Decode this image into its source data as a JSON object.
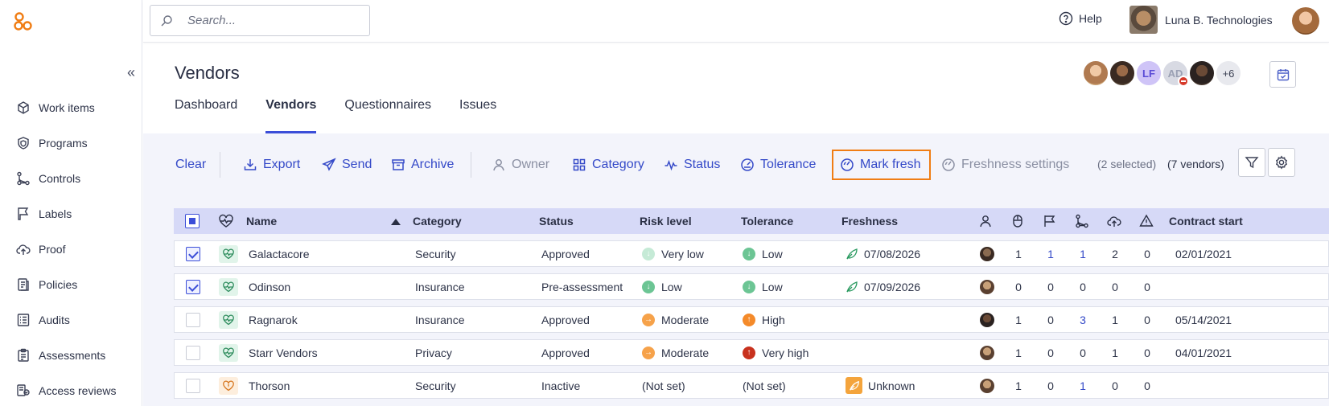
{
  "sidebar": {
    "collapse_label": "«",
    "items": [
      {
        "label": "Work items",
        "icon": "cube-icon"
      },
      {
        "label": "Programs",
        "icon": "shield-icon"
      },
      {
        "label": "Controls",
        "icon": "flow-icon"
      },
      {
        "label": "Labels",
        "icon": "tag-icon"
      },
      {
        "label": "Proof",
        "icon": "cloud-upload-icon"
      },
      {
        "label": "Policies",
        "icon": "document-icon"
      },
      {
        "label": "Audits",
        "icon": "list-icon"
      },
      {
        "label": "Assessments",
        "icon": "clipboard-icon"
      },
      {
        "label": "Access reviews",
        "icon": "people-check-icon"
      }
    ]
  },
  "topbar": {
    "search_placeholder": "Search...",
    "help_label": "Help",
    "org_name": "Luna B. Technologies"
  },
  "header": {
    "title": "Vendors",
    "tabs": [
      {
        "label": "Dashboard",
        "active": false
      },
      {
        "label": "Vendors",
        "active": true
      },
      {
        "label": "Questionnaires",
        "active": false
      },
      {
        "label": "Issues",
        "active": false
      }
    ],
    "avatars": {
      "lf": "LF",
      "ad": "AD",
      "more": "+6"
    }
  },
  "toolbar": {
    "clear": "Clear",
    "export": "Export",
    "send": "Send",
    "archive": "Archive",
    "owner": "Owner",
    "category": "Category",
    "status": "Status",
    "tolerance": "Tolerance",
    "mark_fresh": "Mark fresh",
    "freshness_settings": "Freshness settings",
    "selected_count": "(2 selected)",
    "vendor_count": "(7 vendors)"
  },
  "table": {
    "columns": {
      "name": "Name",
      "category": "Category",
      "status": "Status",
      "risk_level": "Risk level",
      "tolerance": "Tolerance",
      "freshness": "Freshness",
      "contract_start": "Contract start"
    },
    "rows": [
      {
        "checked": true,
        "health": "good",
        "name": "Galactacore",
        "category": "Security",
        "status": "Approved",
        "risk": "Very low",
        "risk_color": "#b8e6cc",
        "tolerance": "Low",
        "tol_color": "#6cc594",
        "freshness": "07/08/2026",
        "fresh_type": "leaf",
        "c1": "1",
        "c2": "1",
        "c3": "1",
        "c4": "2",
        "c5": "0",
        "contract": "02/01/2021",
        "links": [
          false,
          true,
          true,
          false,
          false
        ]
      },
      {
        "checked": true,
        "health": "good",
        "name": "Odinson",
        "category": "Insurance",
        "status": "Pre-assessment",
        "risk": "Low",
        "risk_color": "#6cc594",
        "tolerance": "Low",
        "tol_color": "#6cc594",
        "freshness": "07/09/2026",
        "fresh_type": "leaf",
        "c1": "0",
        "c2": "0",
        "c3": "0",
        "c4": "0",
        "c5": "0",
        "contract": "",
        "links": [
          false,
          false,
          false,
          false,
          false
        ]
      },
      {
        "checked": false,
        "health": "good",
        "name": "Ragnarok",
        "category": "Insurance",
        "status": "Approved",
        "risk": "Moderate",
        "risk_color": "#f6a24a",
        "tolerance": "High",
        "tol_color": "#f48a2a",
        "freshness": "",
        "fresh_type": "none",
        "c1": "1",
        "c2": "0",
        "c3": "3",
        "c4": "1",
        "c5": "0",
        "contract": "05/14/2021",
        "links": [
          false,
          false,
          true,
          false,
          false
        ]
      },
      {
        "checked": false,
        "health": "good",
        "name": "Starr Vendors",
        "category": "Privacy",
        "status": "Approved",
        "risk": "Moderate",
        "risk_color": "#f6a24a",
        "tolerance": "Very high",
        "tol_color": "#c8321e",
        "freshness": "",
        "fresh_type": "none",
        "c1": "1",
        "c2": "0",
        "c3": "0",
        "c4": "1",
        "c5": "0",
        "contract": "04/01/2021",
        "links": [
          false,
          false,
          false,
          false,
          false
        ]
      },
      {
        "checked": false,
        "health": "warn",
        "name": "Thorson",
        "category": "Security",
        "status": "Inactive",
        "risk": "(Not set)",
        "risk_color": "",
        "tolerance": "(Not set)",
        "tol_color": "",
        "freshness": "Unknown",
        "fresh_type": "unknown",
        "c1": "1",
        "c2": "0",
        "c3": "1",
        "c4": "0",
        "c5": "0",
        "contract": "",
        "links": [
          false,
          false,
          true,
          false,
          false
        ]
      }
    ]
  },
  "colors": {
    "accent": "#3449c8",
    "highlight": "#f07d14",
    "header_band": "#d6d9f7",
    "content_bg": "#f3f4fb"
  }
}
